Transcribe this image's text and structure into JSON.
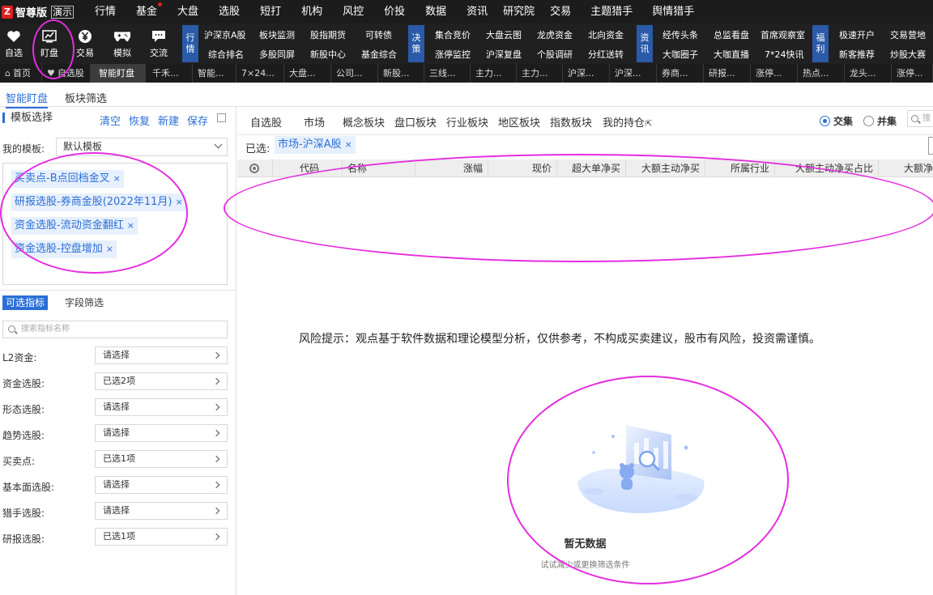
{
  "brand": {
    "logo": "Z",
    "name": "智尊版",
    "demo": "演示"
  },
  "menu": [
    "行情",
    "基金",
    "大盘",
    "选股",
    "短打",
    "机构",
    "风控",
    "价投",
    "数据",
    "资讯",
    "研究院",
    "交易",
    "主题猎手",
    "舆情猎手"
  ],
  "toolbar": {
    "big_buttons": [
      {
        "label": "自选",
        "icon": "heart-icon"
      },
      {
        "label": "盯盘",
        "icon": "chart-monitor-icon"
      },
      {
        "label": "交易",
        "icon": "yen-icon"
      },
      {
        "label": "模拟",
        "icon": "gamepad-icon"
      },
      {
        "label": "交流",
        "icon": "chat-icon"
      }
    ],
    "groups": [
      {
        "tag": "行情",
        "top": [
          "沪深京A股",
          "板块监测",
          "股指期货",
          "可转债"
        ],
        "bottom": [
          "综合排名",
          "多股同屏",
          "新股中心",
          "基金综合"
        ]
      },
      {
        "tag": "决策",
        "top": [
          "集合竞价",
          "大盘云图",
          "龙虎资金",
          "北向资金"
        ],
        "bottom": [
          "涨停监控",
          "沪深复盘",
          "个股调研",
          "分红送转"
        ]
      },
      {
        "tag": "资讯",
        "top": [
          "经传头条",
          "总监看盘",
          "首席观察室"
        ],
        "bottom": [
          "大咖圈子",
          "大咖直播",
          "7*24快讯"
        ]
      },
      {
        "tag": "福利",
        "top": [
          "极速开户",
          "交易营地"
        ],
        "bottom": [
          "新客推荐",
          "炒股大赛"
        ]
      }
    ]
  },
  "tabs": [
    "首页",
    "自选股",
    "智能盯盘",
    "千禾...",
    "智能...",
    "7×24...",
    "大盘...",
    "公司...",
    "新股...",
    "三线...",
    "主力...",
    "主力...",
    "沪深...",
    "沪深...",
    "券商...",
    "研报...",
    "涨停...",
    "热点...",
    "龙头...",
    "涨停..."
  ],
  "subnav": [
    "智能盯盘",
    "板块筛选"
  ],
  "left": {
    "section_title": "模板选择",
    "actions": [
      "清空",
      "恢复",
      "新建",
      "保存"
    ],
    "my_template_label": "我的模板:",
    "my_template_value": "默认模板",
    "chips": [
      "买卖点-B点回档金叉",
      "研报选股-券商金股(2022年11月)",
      "资金选股-流动资金翻红",
      "资金选股-控盘增加"
    ],
    "indicator_tabs": [
      "可选指标",
      "字段筛选"
    ],
    "search_placeholder": "搜索指标名称",
    "rows": [
      {
        "label": "L2资金:",
        "value": "请选择"
      },
      {
        "label": "资金选股:",
        "value": "已选2项"
      },
      {
        "label": "形态选股:",
        "value": "请选择"
      },
      {
        "label": "趋势选股:",
        "value": "请选择"
      },
      {
        "label": "买卖点:",
        "value": "已选1项"
      },
      {
        "label": "基本面选股:",
        "value": "请选择"
      },
      {
        "label": "猎手选股:",
        "value": "请选择"
      },
      {
        "label": "研报选股:",
        "value": "已选1项"
      }
    ]
  },
  "right": {
    "tabs": [
      "自选股",
      "市场",
      "概念板块",
      "盘口板块",
      "行业板块",
      "地区板块",
      "指数板块",
      "我的持仓"
    ],
    "radio": [
      {
        "label": "交集",
        "checked": true
      },
      {
        "label": "并集",
        "checked": false
      }
    ],
    "search_placeholder": "搜",
    "selected_label": "已选:",
    "selected_chip": "市场-沪深A股",
    "columns": [
      "代码",
      "名称",
      "涨幅",
      "现价",
      "超大单净买",
      "大额主动净买",
      "所属行业",
      "大额主动净买占比",
      "大额净"
    ],
    "risk_notice": "风险提示：观点基于软件数据和理论模型分析，仅供参考，不构成买卖建议，股市有风险，投资需谨慎。",
    "empty_title": "暂无数据",
    "empty_sub": "试试减少或更换筛选条件"
  },
  "colors": {
    "accent": "#2b6fd6",
    "annotation": "#e52de0",
    "menubar": "#1c1c1c",
    "tag_blue": "#2a5aa8"
  }
}
